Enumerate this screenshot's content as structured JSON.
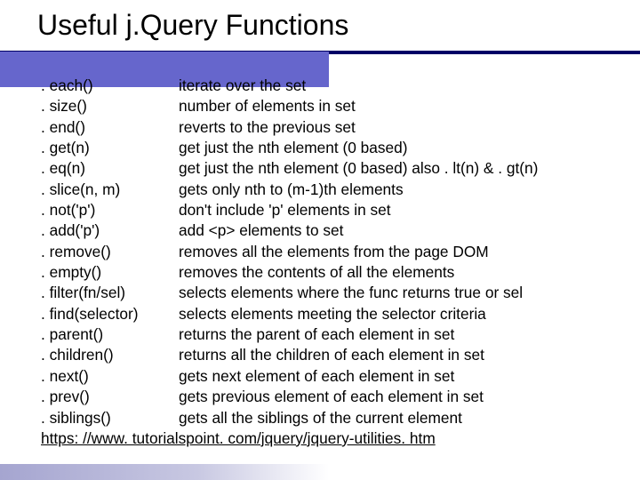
{
  "title": "Useful j.Query Functions",
  "rows": [
    {
      "fn": ". each()",
      "desc": "iterate over the set"
    },
    {
      "fn": ". size()",
      "desc": "number of elements in set"
    },
    {
      "fn": ". end()",
      "desc": "reverts to the previous set"
    },
    {
      "fn": ". get(n)",
      "desc": "get just the nth element (0 based)"
    },
    {
      "fn": ". eq(n)",
      "desc": "get just the nth element (0 based) also . lt(n) & . gt(n)"
    },
    {
      "fn": ". slice(n, m)",
      "desc": "gets only nth to (m-1)th elements"
    },
    {
      "fn": ". not('p')",
      "desc": "don't include 'p' elements in set"
    },
    {
      "fn": ". add('p')",
      "desc": "add <p> elements to set"
    },
    {
      "fn": ". remove()",
      "desc": "removes all the elements from the page DOM"
    },
    {
      "fn": ". empty()",
      "desc": "removes the contents of all the elements"
    },
    {
      "fn": ". filter(fn/sel)",
      "desc": "selects elements where the func returns true or sel"
    },
    {
      "fn": ". find(selector)",
      "desc": "selects elements meeting the selector criteria"
    },
    {
      "fn": ". parent()",
      "desc": "returns the parent of each element in set"
    },
    {
      "fn": ". children()",
      "desc": "returns all the children of each element in set"
    },
    {
      "fn": ". next()",
      "desc": "gets next element of each element in set"
    },
    {
      "fn": ". prev()",
      "desc": "gets previous element of each element in set"
    },
    {
      "fn": ". siblings()",
      "desc": "gets all the siblings of the current element"
    }
  ],
  "link": "https: //www. tutorialspoint. com/jquery/jquery-utilities. htm"
}
